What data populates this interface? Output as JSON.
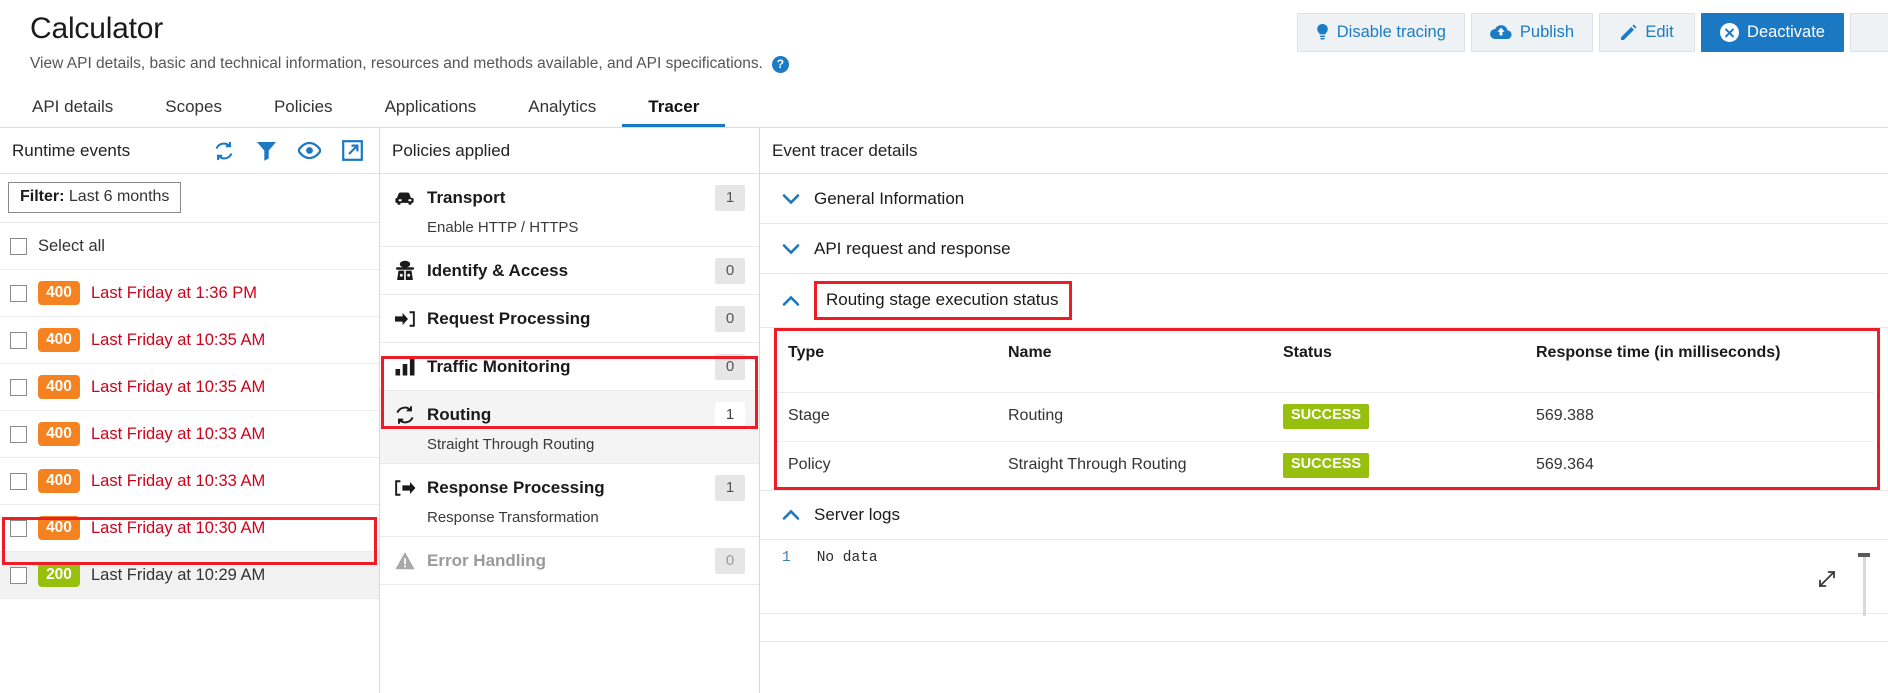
{
  "header": {
    "title": "Calculator",
    "subtitle": "View API details, basic and technical information, resources and methods available, and API specifications.",
    "help_icon": "help-circle-icon",
    "actions": [
      {
        "label": "Disable tracing",
        "icon": "lightbulb-icon",
        "style": "secondary"
      },
      {
        "label": "Publish",
        "icon": "cloud-upload-icon",
        "style": "secondary"
      },
      {
        "label": "Edit",
        "icon": "pencil-icon",
        "style": "secondary"
      },
      {
        "label": "Deactivate",
        "icon": "close-circle-icon",
        "style": "primary"
      }
    ]
  },
  "tabs": [
    {
      "label": "API details",
      "active": false
    },
    {
      "label": "Scopes",
      "active": false
    },
    {
      "label": "Policies",
      "active": false
    },
    {
      "label": "Applications",
      "active": false
    },
    {
      "label": "Analytics",
      "active": false
    },
    {
      "label": "Tracer",
      "active": true
    }
  ],
  "runtime_events": {
    "title": "Runtime events",
    "icons": [
      "refresh-icon",
      "filter-icon",
      "eye-icon",
      "external-link-icon"
    ],
    "filter": {
      "prefix": "Filter:",
      "value": "Last 6 months"
    },
    "select_all_label": "Select all",
    "events": [
      {
        "code": "400",
        "code_type": "error",
        "time": "Last Friday at 1:36 PM",
        "selected": false
      },
      {
        "code": "400",
        "code_type": "error",
        "time": "Last Friday at 10:35 AM",
        "selected": false
      },
      {
        "code": "400",
        "code_type": "error",
        "time": "Last Friday at 10:35 AM",
        "selected": false
      },
      {
        "code": "400",
        "code_type": "error",
        "time": "Last Friday at 10:33 AM",
        "selected": false
      },
      {
        "code": "400",
        "code_type": "error",
        "time": "Last Friday at 10:33 AM",
        "selected": false
      },
      {
        "code": "400",
        "code_type": "error",
        "time": "Last Friday at 10:30 AM",
        "selected": false
      },
      {
        "code": "200",
        "code_type": "success",
        "time": "Last Friday at 10:29 AM",
        "selected": true
      }
    ]
  },
  "policies_applied": {
    "title": "Policies applied",
    "rows": [
      {
        "icon": "car-icon",
        "name": "Transport",
        "count": "1",
        "sub": "Enable HTTP / HTTPS",
        "highlighted": false,
        "disabled": false
      },
      {
        "icon": "spy-icon",
        "name": "Identify & Access",
        "count": "0",
        "sub": "",
        "highlighted": false,
        "disabled": false
      },
      {
        "icon": "arrow-into-bracket-icon",
        "name": "Request Processing",
        "count": "0",
        "sub": "",
        "highlighted": false,
        "disabled": false
      },
      {
        "icon": "bar-chart-icon",
        "name": "Traffic Monitoring",
        "count": "0",
        "sub": "",
        "highlighted": false,
        "disabled": false
      },
      {
        "icon": "refresh-cycle-icon",
        "name": "Routing",
        "count": "1",
        "sub": "Straight Through Routing",
        "highlighted": true,
        "disabled": false
      },
      {
        "icon": "arrow-out-bracket-icon",
        "name": "Response Processing",
        "count": "1",
        "sub": "Response Transformation",
        "highlighted": false,
        "disabled": false
      },
      {
        "icon": "warning-triangle-icon",
        "name": "Error Handling",
        "count": "0",
        "sub": "",
        "highlighted": false,
        "disabled": true
      }
    ]
  },
  "event_tracer": {
    "title": "Event tracer details",
    "sections": [
      {
        "label": "General Information",
        "expanded": false,
        "boxed": false
      },
      {
        "label": "API request and response",
        "expanded": false,
        "boxed": false
      },
      {
        "label": "Routing stage execution status",
        "expanded": true,
        "boxed": true
      }
    ],
    "table": {
      "columns": [
        "Type",
        "Name",
        "Status",
        "Response time (in milliseconds)"
      ],
      "rows": [
        {
          "type": "Stage",
          "name": "Routing",
          "status": "SUCCESS",
          "response_time": "569.388"
        },
        {
          "type": "Policy",
          "name": "Straight Through Routing",
          "status": "SUCCESS",
          "response_time": "569.364"
        }
      ]
    },
    "server_logs": {
      "label": "Server logs",
      "expanded": true,
      "line_number": "1",
      "content": "No data",
      "resize_icon": "expand-diagonal-icon"
    }
  },
  "colors": {
    "accent_blue": "#1b78c2",
    "status_400": "#f58220",
    "status_200": "#97bf0d",
    "error_text": "#d0021b",
    "annotation_red": "#ee1c25",
    "success_pill": "#97bf0d"
  }
}
